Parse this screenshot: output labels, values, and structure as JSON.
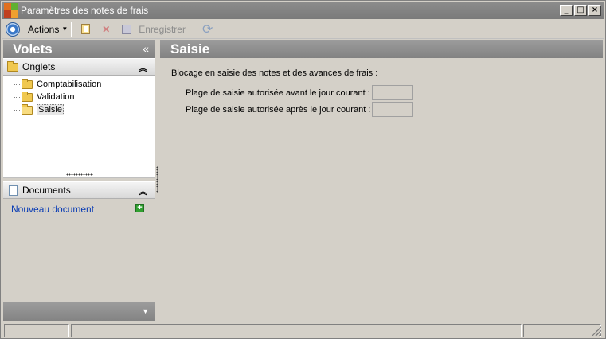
{
  "window": {
    "title": "Paramètres des notes de frais"
  },
  "toolbar": {
    "actions_label": "Actions",
    "save_label": "Enregistrer"
  },
  "left": {
    "title": "Volets",
    "collapse_glyph": "«",
    "tabs_section": {
      "label": "Onglets",
      "items": [
        {
          "label": "Comptabilisation"
        },
        {
          "label": "Validation"
        },
        {
          "label": "Saisie",
          "selected": true
        }
      ]
    },
    "docs_section": {
      "label": "Documents",
      "new_doc_label": "Nouveau document"
    }
  },
  "right": {
    "title": "Saisie",
    "heading": "Blocage en saisie des notes et des avances de frais :",
    "fields": [
      {
        "label": "Plage de saisie autorisée avant le jour courant :",
        "value": ""
      },
      {
        "label": "Plage de saisie autorisée après le jour courant :",
        "value": ""
      }
    ]
  }
}
